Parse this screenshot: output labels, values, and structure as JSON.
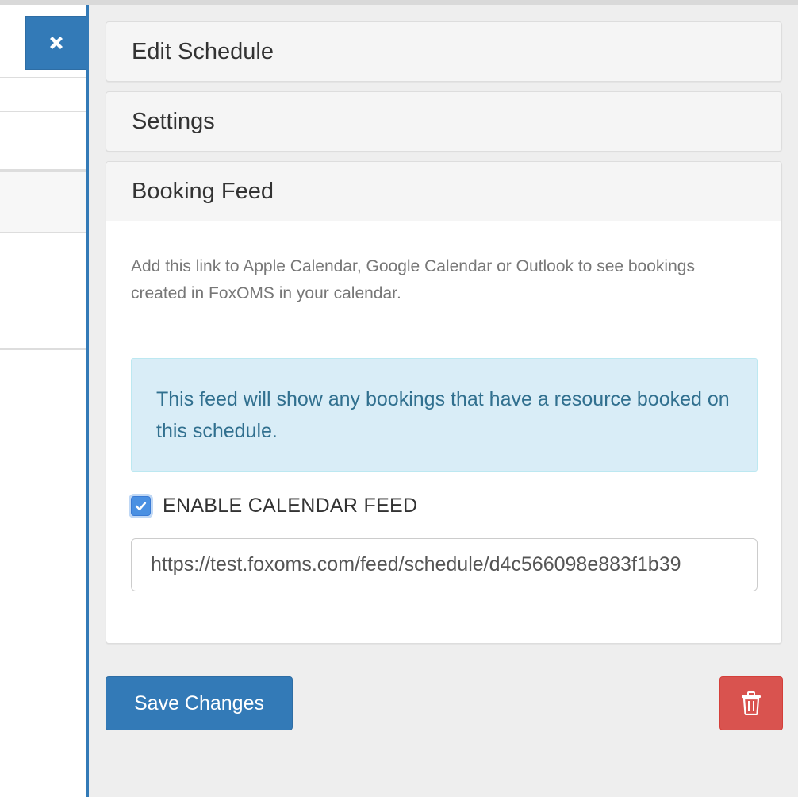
{
  "panel": {
    "accordion": [
      {
        "title": "Edit Schedule"
      },
      {
        "title": "Settings"
      },
      {
        "title": "Booking Feed"
      }
    ],
    "booking_feed": {
      "description": "Add this link to Apple Calendar, Google Calendar or Outlook to see bookings created in FoxOMS in your calendar.",
      "info_alert": "This feed will show any bookings that have a resource booked on this schedule.",
      "enable_label": "ENABLE CALENDAR FEED",
      "enabled": true,
      "feed_url": "https://test.foxoms.com/feed/schedule/d4c566098e883f1b39"
    },
    "save_label": "Save Changes"
  },
  "icons": {
    "close": "close-icon",
    "delete": "trash-icon",
    "checkbox": "checkmark-icon"
  },
  "colors": {
    "primary": "#337ab7",
    "danger": "#d9534f",
    "info_bg": "#d9edf7",
    "info_text": "#31708f",
    "checkbox": "#4a90e2"
  }
}
